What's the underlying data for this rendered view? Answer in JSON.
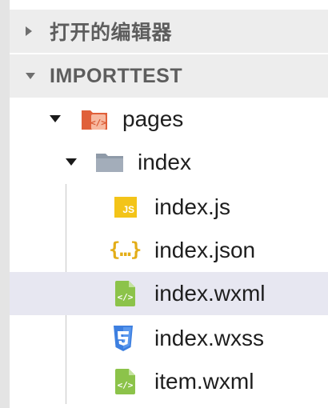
{
  "sections": {
    "open_editors": {
      "label": "打开的编辑器",
      "icon": "chevron-right-icon"
    },
    "project": {
      "label": "IMPORTTEST",
      "icon": "chevron-down-icon"
    }
  },
  "tree": {
    "pages": {
      "label": "pages",
      "icon": "pages-folder-icon"
    },
    "index_folder": {
      "label": "index",
      "icon": "folder-icon"
    },
    "files": [
      {
        "label": "index.js",
        "icon": "js-file-icon"
      },
      {
        "label": "index.json",
        "icon": "json-file-icon"
      },
      {
        "label": "index.wxml",
        "icon": "wxml-file-icon",
        "selected": true
      },
      {
        "label": "index.wxss",
        "icon": "css-file-icon"
      },
      {
        "label": "item.wxml",
        "icon": "wxml-file-icon"
      }
    ]
  },
  "colors": {
    "header_bg": "#ededed",
    "selected_bg": "#e7e7f1",
    "js": "#f3c419",
    "json": "#e3ad17",
    "wxml": "#8cc34a",
    "css": "#3d7fe0",
    "folder": "#8f9aa8",
    "pages_folder": "#e0603a"
  }
}
